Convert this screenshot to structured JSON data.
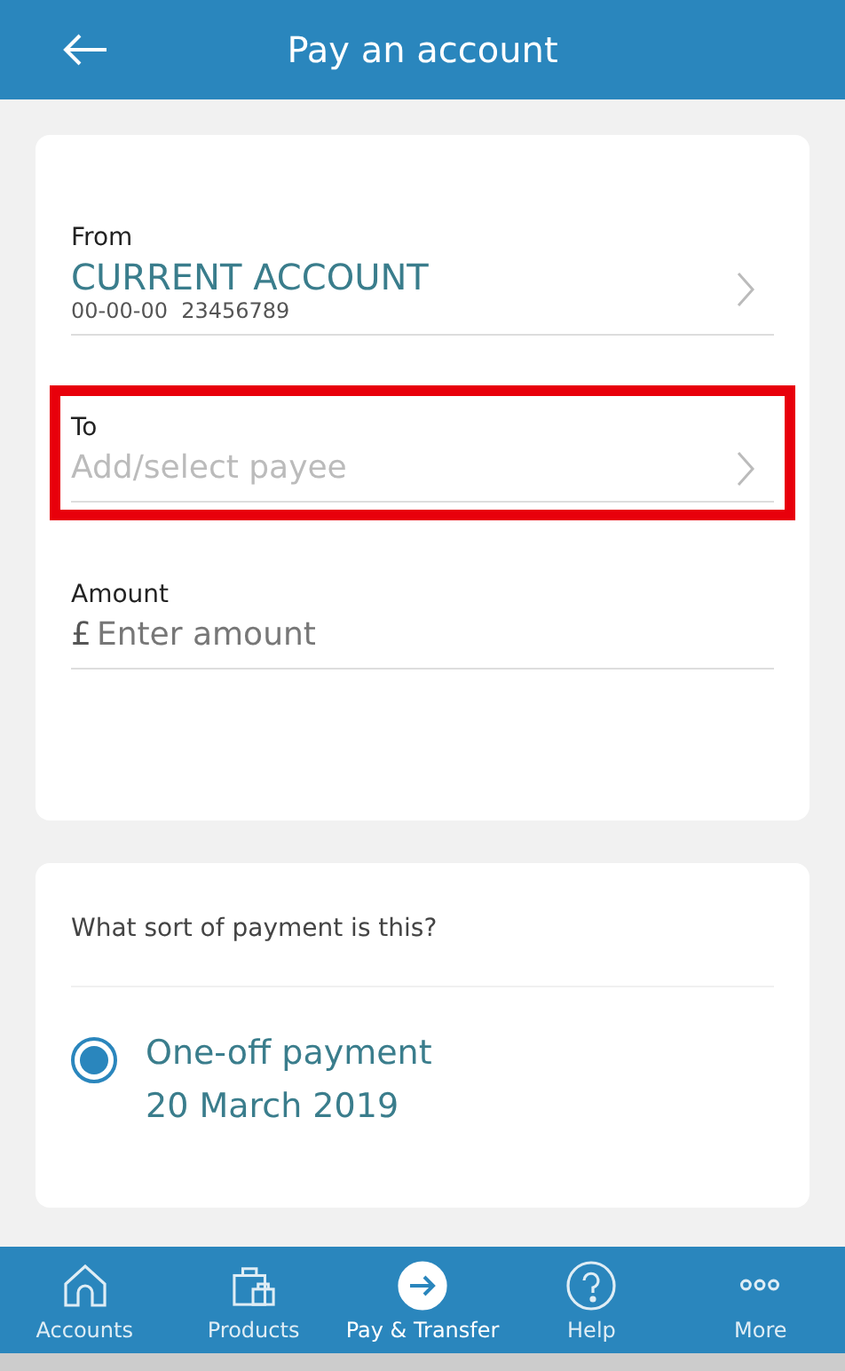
{
  "header": {
    "title": "Pay an account"
  },
  "fields": [
    {
      "label": "From",
      "value": "CURRENT ACCOUNT",
      "detail": "00-00-00  23456789",
      "kind": "select",
      "highlighted": false
    },
    {
      "label": "To",
      "placeholder": "Add/select payee",
      "kind": "select",
      "highlighted": true
    },
    {
      "label": "Amount",
      "currency": "£",
      "placeholder": "Enter amount",
      "kind": "input",
      "highlighted": false
    }
  ],
  "payment_type": {
    "question": "What sort of payment is this?",
    "options": [
      {
        "label": "One-off payment",
        "date": "20 March 2019",
        "selected": true
      }
    ]
  },
  "nav": [
    {
      "label": "Accounts",
      "selected": false
    },
    {
      "label": "Products",
      "selected": false
    },
    {
      "label": "Pay & Transfer",
      "selected": true
    },
    {
      "label": "Help",
      "selected": false
    },
    {
      "label": "More",
      "selected": false
    }
  ]
}
